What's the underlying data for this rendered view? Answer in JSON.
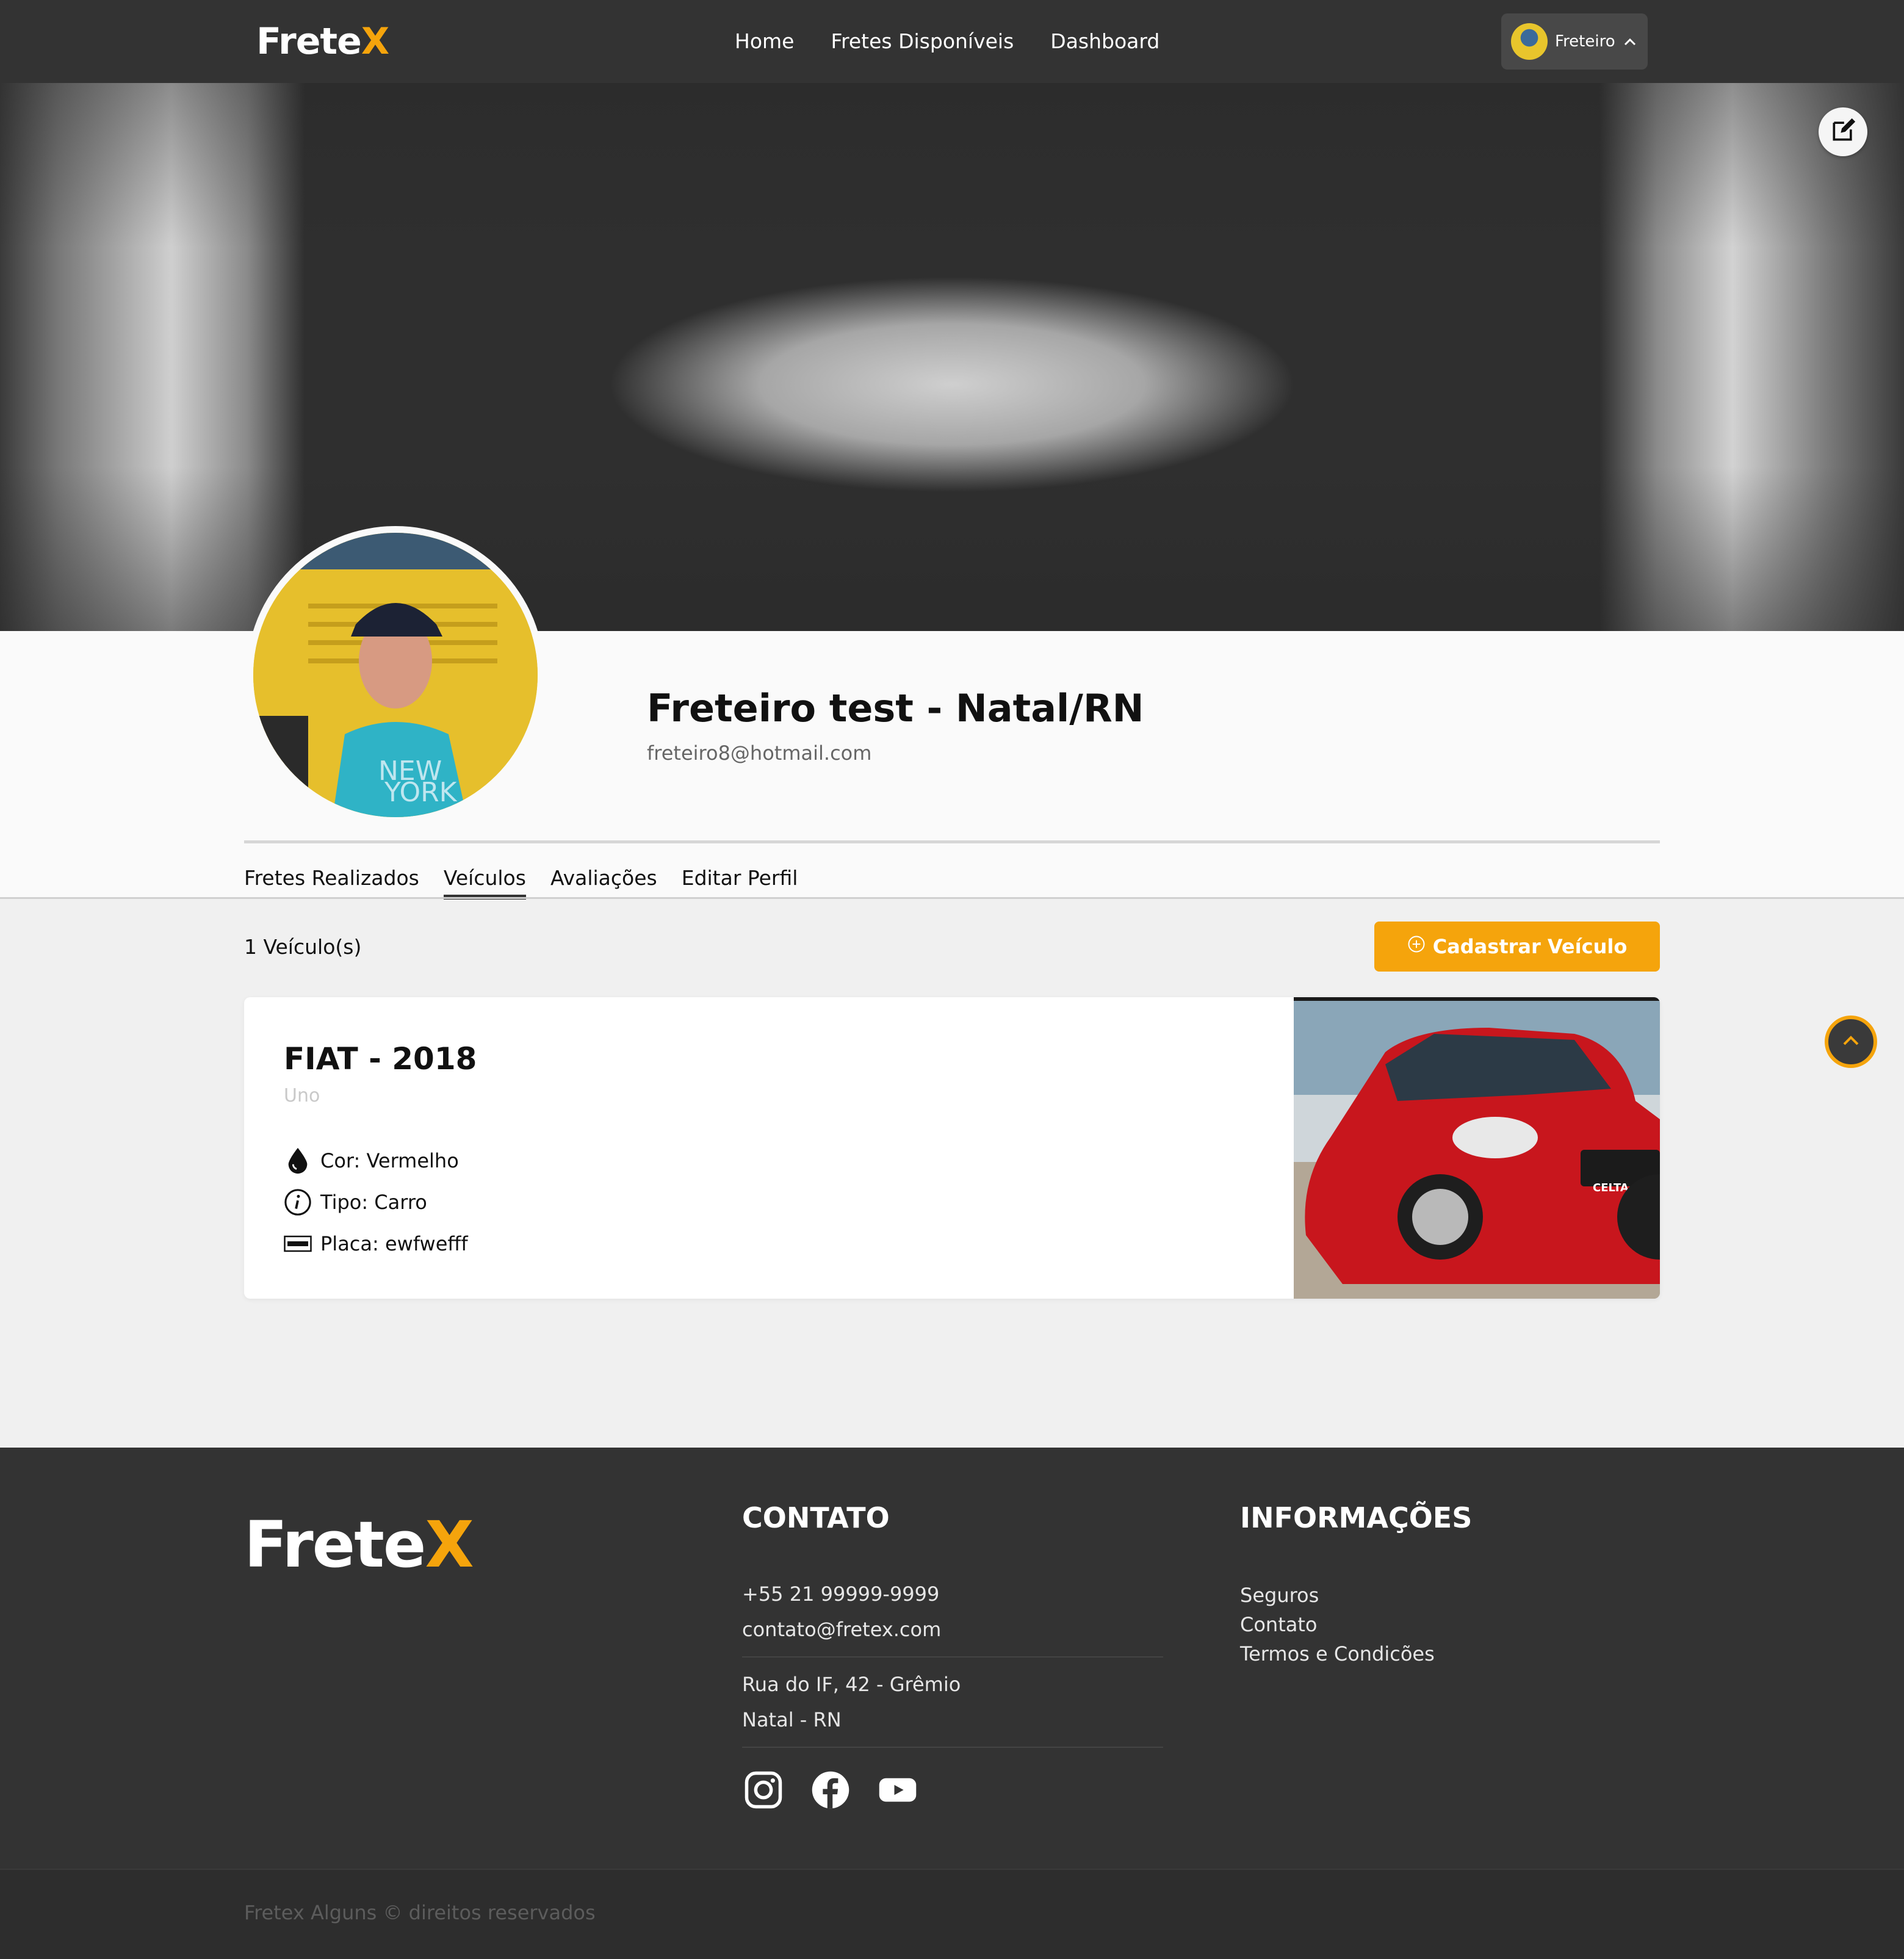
{
  "navbar": {
    "brand_main": "Frete",
    "brand_accent": "X",
    "links": [
      "Home",
      "Fretes Disponíveis",
      "Dashboard"
    ],
    "user_label": "Freteiro",
    "user_chevron_icon": "chevron-up-icon"
  },
  "profile": {
    "name": "Freteiro test - Natal/RN",
    "email": "freteiro8@hotmail.com",
    "cover_edit_icon": "edit-icon"
  },
  "tabs": [
    {
      "label": "Fretes Realizados",
      "active": false
    },
    {
      "label": "Veículos",
      "active": true
    },
    {
      "label": "Avaliações",
      "active": false
    },
    {
      "label": "Editar Perfil",
      "active": false
    }
  ],
  "vehicles": {
    "count_label": "1 Veículo(s)",
    "add_button_label": "Cadastrar Veículo",
    "add_button_icon": "plus-circle-icon",
    "items": [
      {
        "title": "FIAT - 2018",
        "model": "Uno",
        "color": "Cor: Vermelho",
        "type": "Tipo: Carro",
        "plate": "Placa: ewfwefff",
        "image_text": "CELTA"
      }
    ]
  },
  "footer": {
    "brand_main": "Frete",
    "brand_accent": "X",
    "contact": {
      "heading": "CONTATO",
      "phone": "+55 21 99999-9999",
      "email": "contato@fretex.com",
      "address_line1": "Rua do IF, 42 - Grêmio",
      "address_line2": "Natal - RN"
    },
    "info": {
      "heading": "INFORMAÇÕES",
      "links": [
        "Seguros",
        "Contato",
        "Termos e Condicões"
      ]
    },
    "social_icons": [
      "instagram-icon",
      "facebook-icon",
      "youtube-icon"
    ],
    "copyright": "Fretex Alguns © direitos reservados"
  },
  "colors": {
    "accent": "#f5a40c",
    "navbar_bg": "#333333",
    "page_bg": "#f0f0f0"
  }
}
